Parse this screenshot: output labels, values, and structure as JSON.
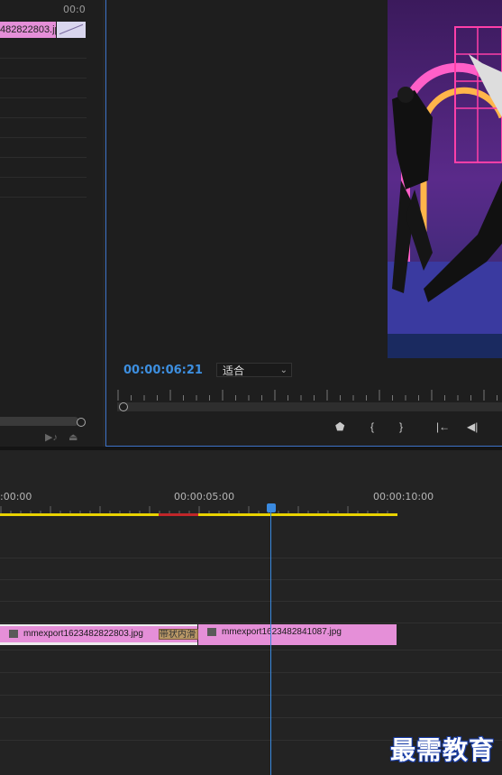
{
  "source_monitor": {
    "timecode": "00:0",
    "clip_label": "482822803.jp"
  },
  "program_monitor": {
    "timecode": "00:00:06:21",
    "zoom": "适合",
    "controls": [
      "marker-icon",
      "mark-in-icon",
      "mark-out-icon",
      "go-to-in-icon",
      "step-back-icon"
    ]
  },
  "timeline": {
    "ruler_labels": [
      ":00:00",
      "00:00:05:00",
      "00:00:10:00"
    ],
    "clips": [
      {
        "name": "mmexport1623482822803.jpg"
      },
      {
        "name": "mmexport1623482841087.jpg"
      }
    ],
    "transition_label": "带状内滑"
  },
  "watermark": "最需教育",
  "colors": {
    "clip": "#e58fd8",
    "playhead": "#3a8ae0",
    "timecode": "#3d8fe0",
    "work_area": "#e8d200",
    "render_bar": "#c0262a"
  }
}
